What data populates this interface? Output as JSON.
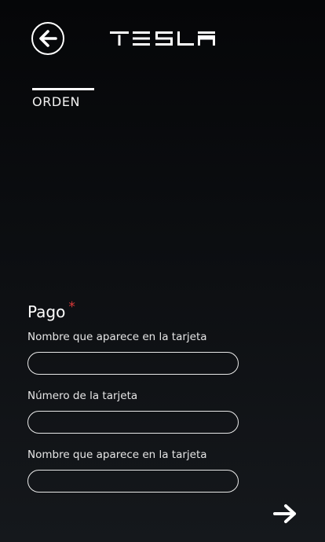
{
  "header": {
    "back_icon": "arrow-left-circle-icon",
    "logo_text": "TESLA"
  },
  "tabs": [
    {
      "label": "ORDEN",
      "active": true
    }
  ],
  "payment": {
    "title": "Pago",
    "required_mark": "*",
    "fields": [
      {
        "label": "Nombre que aparece en la tarjeta",
        "value": "",
        "placeholder": ""
      },
      {
        "label": "Número de la tarjeta",
        "value": "",
        "placeholder": ""
      },
      {
        "label": "Nombre que aparece en la tarjeta",
        "value": "",
        "placeholder": ""
      }
    ]
  },
  "footer": {
    "next_icon": "arrow-right-icon"
  },
  "colors": {
    "background_top": "#050608",
    "background_bottom": "#15181c",
    "text": "#ffffff",
    "required": "#e03a3a",
    "input_border": "#e8e8e8"
  }
}
